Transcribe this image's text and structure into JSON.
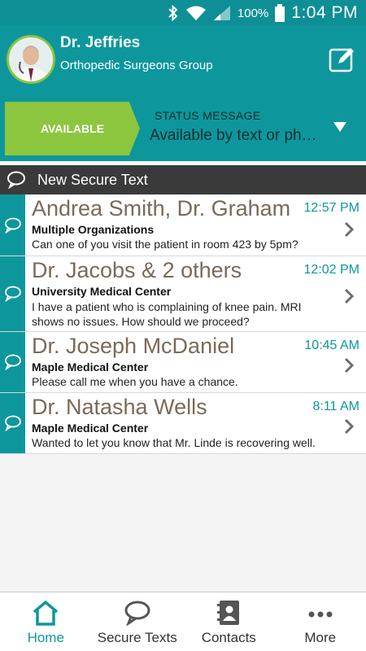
{
  "statusbar": {
    "battery": "100%",
    "time": "1:04 PM"
  },
  "header": {
    "name": "Dr. Jeffries",
    "organization": "Orthopedic Surgeons Group"
  },
  "status": {
    "availability": "AVAILABLE",
    "label": "STATUS MESSAGE",
    "message": "Available by text or phone"
  },
  "new_text": {
    "label": "New Secure Text"
  },
  "messages": [
    {
      "name": "Andrea Smith, Dr. Graham",
      "time": "12:57 PM",
      "org": "Multiple Organizations",
      "preview": "Can one of you visit the patient in room 423 by 5pm?"
    },
    {
      "name": "Dr. Jacobs & 2 others",
      "time": "12:02 PM",
      "org": "University Medical Center",
      "preview": "I have a patient who is complaining of knee pain. MRI shows no issues. How should we proceed?"
    },
    {
      "name": "Dr. Joseph McDaniel",
      "time": "10:45 AM",
      "org": "Maple Medical Center",
      "preview": "Please call me when you have a chance."
    },
    {
      "name": "Dr. Natasha Wells",
      "time": "8:11 AM",
      "org": "Maple Medical Center",
      "preview": "Wanted to let you know that Mr. Linde is recovering well."
    }
  ],
  "nav": [
    {
      "label": "Home",
      "icon": "home-icon",
      "active": true
    },
    {
      "label": "Secure Texts",
      "icon": "chat-bubbles-icon"
    },
    {
      "label": "Contacts",
      "icon": "contacts-book-icon"
    },
    {
      "label": "More",
      "icon": "more-dots-icon"
    }
  ],
  "colors": {
    "teal": "#0d979d",
    "green": "#8cc63f",
    "dark_bar": "#3a3a3a",
    "name_brown": "#7a6a58"
  }
}
